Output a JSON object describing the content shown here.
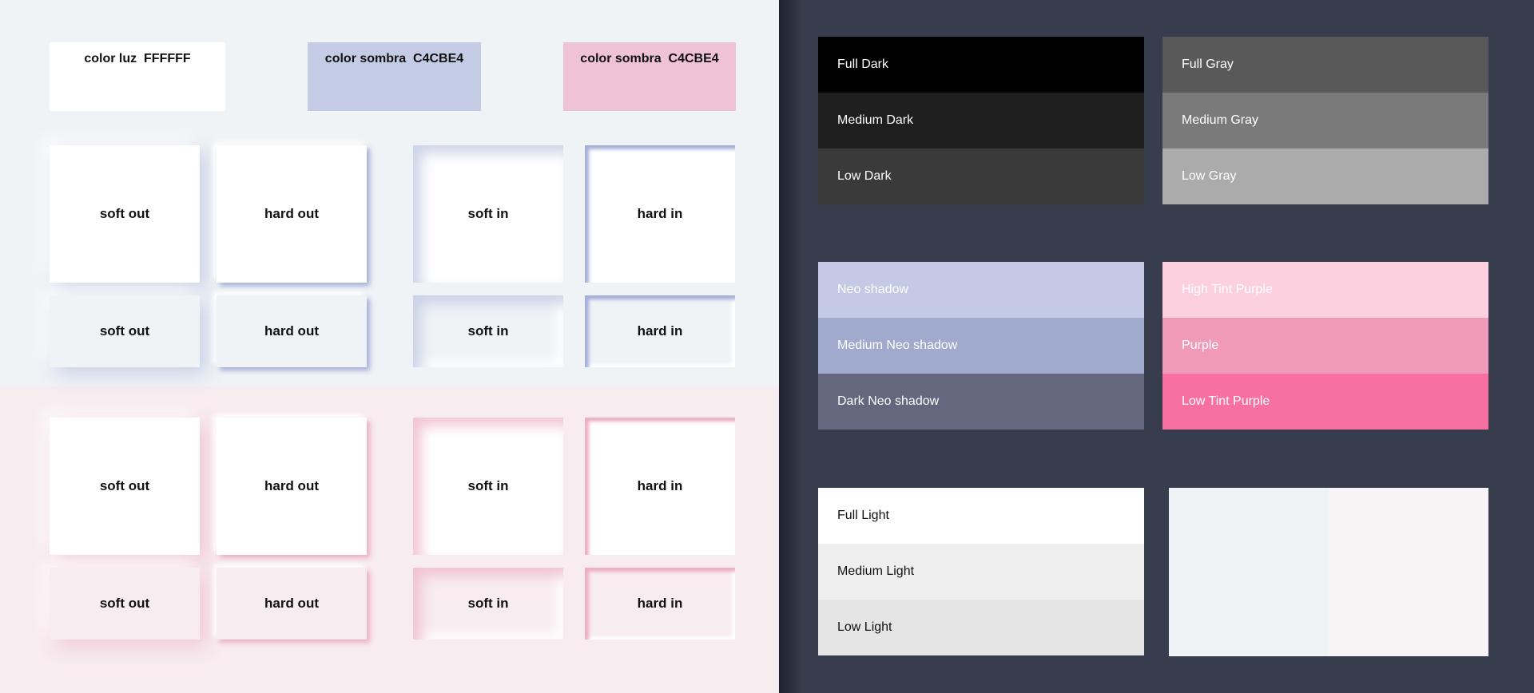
{
  "swatches": [
    {
      "label": "color luz  FFFFFF",
      "color": "#ffffff"
    },
    {
      "label": "color sombra  C4CBE4",
      "color": "#c4cbe4"
    },
    {
      "label": "color sombra  C4CBE4",
      "color": "#efc3d3"
    }
  ],
  "tiles": {
    "soft_out": "soft out",
    "hard_out": "hard out",
    "soft_in": "soft in",
    "hard_in": "hard in"
  },
  "palettes": {
    "dark": [
      {
        "label": "Full Dark",
        "color": "#000000",
        "text_color": "#ffffff"
      },
      {
        "label": "Medium Dark",
        "color": "#1e1e1e",
        "text_color": "#ffffff"
      },
      {
        "label": "Low Dark",
        "color": "#3a3a3a",
        "text_color": "#ffffff"
      }
    ],
    "gray": [
      {
        "label": "Full Gray",
        "color": "#595959",
        "text_color": "#ffffff"
      },
      {
        "label": "Medium  Gray",
        "color": "#7a7a7a",
        "text_color": "#ffffff"
      },
      {
        "label": "Low Gray",
        "color": "#ababab",
        "text_color": "#ffffff"
      }
    ],
    "neo": [
      {
        "label": "Neo shadow",
        "color": "#c4c9e5",
        "text_color": "#ffffff"
      },
      {
        "label": "Medium Neo shadow",
        "color": "#a0aacd",
        "text_color": "#ffffff"
      },
      {
        "label": "Dark Neo shadow",
        "color": "#63687f",
        "text_color": "#ffffff"
      }
    ],
    "purple": [
      {
        "label": "High Tint Purple",
        "color": "#fdd0e0",
        "text_color": "#ffffff"
      },
      {
        "label": "Purple",
        "color": "#f09ab8",
        "text_color": "#ffffff"
      },
      {
        "label": "Low Tint Purple",
        "color": "#f7709f",
        "text_color": "#ffffff"
      }
    ],
    "light": [
      {
        "label": "Full Light",
        "color": "#ffffff",
        "text_color": "#111111"
      },
      {
        "label": "Medium Light",
        "color": "#efefef",
        "text_color": "#111111"
      },
      {
        "label": "Low Light",
        "color": "#e5e5e5",
        "text_color": "#111111"
      }
    ],
    "backgrounds": [
      {
        "color": "#eff3f6"
      },
      {
        "color": "#f8f4f6"
      }
    ]
  }
}
